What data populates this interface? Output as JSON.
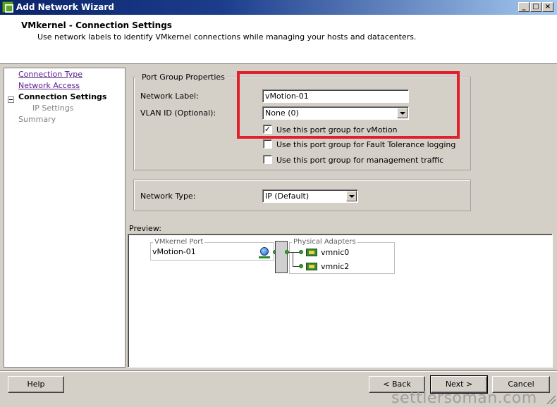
{
  "window": {
    "title": "Add Network Wizard",
    "buttons": {
      "minimize": "_",
      "maximize": "□",
      "close": "×"
    }
  },
  "header": {
    "title": "VMkernel - Connection Settings",
    "subtitle": "Use network labels to identify VMkernel connections while managing your hosts and datacenters."
  },
  "nav": {
    "items": [
      {
        "label": "Connection Type"
      },
      {
        "label": "Network Access"
      },
      {
        "label": "Connection Settings"
      },
      {
        "label": "IP Settings"
      },
      {
        "label": "Summary"
      }
    ]
  },
  "port_group": {
    "legend": "Port Group Properties",
    "network_label": {
      "label": "Network Label:",
      "value": "vMotion-01"
    },
    "vlan_id": {
      "label": "VLAN ID (Optional):",
      "value": "None (0)"
    },
    "checkboxes": [
      {
        "label": "Use this port group for vMotion",
        "checked": true,
        "mark": "✓"
      },
      {
        "label": "Use this port group for Fault Tolerance logging",
        "checked": false,
        "mark": ""
      },
      {
        "label": "Use this port group for management traffic",
        "checked": false,
        "mark": ""
      }
    ]
  },
  "network_type": {
    "label": "Network Type:",
    "value": "IP (Default)"
  },
  "preview": {
    "label": "Preview:",
    "vmkernel_port": {
      "caption": "VMkernel Port",
      "name": "vMotion-01"
    },
    "physical_adapters": {
      "caption": "Physical Adapters",
      "items": [
        "vmnic0",
        "vmnic2"
      ]
    }
  },
  "buttons": {
    "help": "Help",
    "back": "< Back",
    "next": "Next >",
    "cancel": "Cancel"
  },
  "watermark": "settlersoman.com",
  "colors": {
    "highlight": "#e0202c",
    "titlebar": "#0a246a"
  }
}
